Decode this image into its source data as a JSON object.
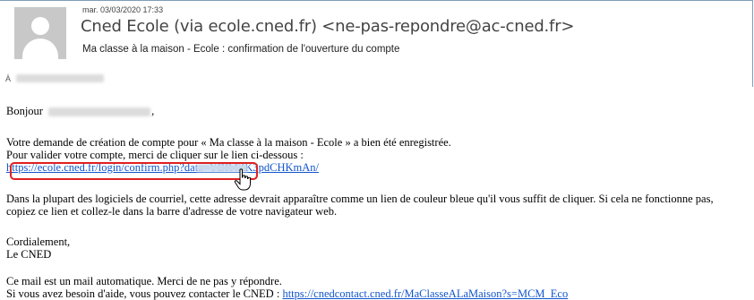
{
  "header": {
    "date": "mar. 03/03/2020 17:33",
    "sender": "Cned Ecole (via ecole.cned.fr) <ne-pas-repondre@ac-cned.fr>",
    "subject": "Ma classe à la maison - Ecole : confirmation de l'ouverture du compte",
    "to_label": "À"
  },
  "body": {
    "greeting": "Bonjour",
    "greeting_suffix": ",",
    "para1_line1": "Votre demande de création de compte pour « Ma classe à la maison - Ecole » a bien été enregistrée.",
    "para1_line2": "Pour valider votre compte, merci de cliquer sur le lien ci-dessous :",
    "confirm_link": "https://ecole.cned.fr/login/confirm.php?data=YBR4ZK3pdCHKmAn/",
    "para2_line1": "Dans la plupart des logiciels de courriel, cette adresse devrait apparaître comme un lien de couleur bleue qu'il vous suffit de cliquer. Si cela ne fonctionne pas,",
    "para2_line2": "copiez ce lien et collez-le dans la barre d'adresse de votre navigateur web.",
    "closing1": "Cordialement,",
    "closing2": "Le CNED",
    "footer1": "Ce mail est un mail automatique. Merci de ne pas y répondre.",
    "footer2": "Si vous avez besoin d'aide, vous pouvez contacter le CNED : ",
    "help_link": "https://cnedcontact.cned.fr/MaClasseALaMaison?s=MCM_Eco"
  },
  "icons": {
    "avatar": "person-placeholder-icon",
    "cursor": "hand-pointer-icon"
  },
  "colors": {
    "link": "#1155cc",
    "highlight": "#e02020"
  }
}
